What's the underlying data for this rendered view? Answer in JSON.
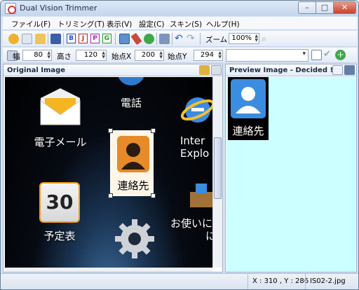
{
  "window": {
    "title": "Dual Vision Trimmer"
  },
  "menu": [
    "ファイル(F)",
    "トリミング(T)",
    "表示(V)",
    "設定(C)",
    "スキン(S)",
    "ヘルプ(H)"
  ],
  "toolbar": {
    "letters": [
      "B",
      "J",
      "P",
      "G"
    ],
    "zoom_label": "ズーム",
    "zoom_value": "100%"
  },
  "fields": {
    "width_label": "幅",
    "width_value": "80",
    "height_label": "高さ",
    "height_value": "120",
    "startx_label": "始点X",
    "startx_value": "200",
    "starty_label": "始点Y",
    "starty_value": "294",
    "combo_value": ""
  },
  "left_pane": {
    "title": "Original Image",
    "apps": {
      "email": "電子メール",
      "phone": "電話",
      "contacts": "連絡先",
      "ie_line1": "Inter",
      "ie_line2": "Explo",
      "calendar_day": "30",
      "calendar": "予定表",
      "useful_line1": "お使いに",
      "useful_line2": "に"
    }
  },
  "right_pane": {
    "title": "Preview Image - Decided !",
    "tile_label": "連絡先"
  },
  "status": {
    "coords": "X : 310 , Y : 286",
    "file": "IS02-2.jpg"
  },
  "colors": {
    "preview_bg": "#ccffff",
    "titlebar": "#c4d6ec",
    "close_button": "#c8402a"
  }
}
